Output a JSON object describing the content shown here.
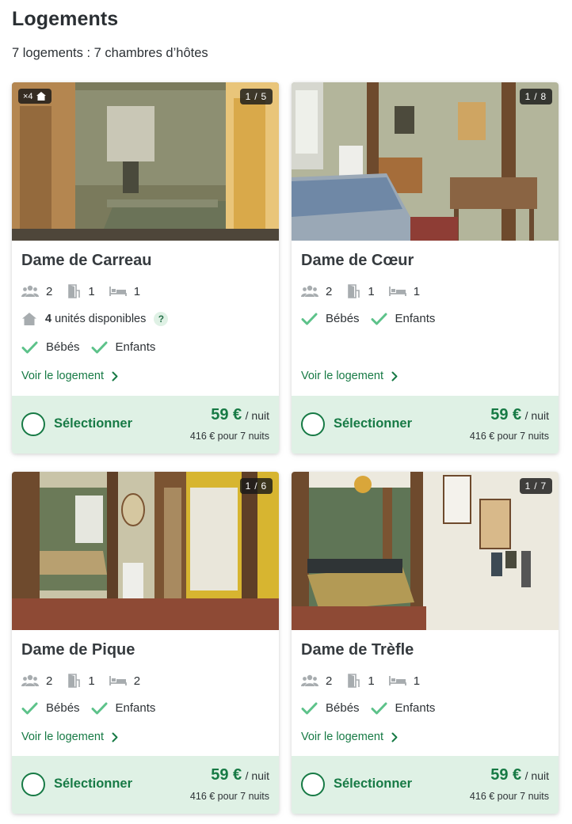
{
  "page": {
    "title": "Logements",
    "subtitle": "7 logements : 7 chambres d’hôtes"
  },
  "listings": [
    {
      "name": "Dame de Carreau",
      "photo_counter": "1 / 5",
      "units_badge": "×4",
      "guests": "2",
      "rooms": "1",
      "beds": "1",
      "availability_count": "4",
      "availability_text": "unités disponibles",
      "availability_help": "?",
      "feature_1": "Bébés",
      "feature_2": "Enfants",
      "link": "Voir le logement",
      "select_label": "Sélectionner",
      "price": "59 €",
      "price_unit": "/ nuit",
      "total": "416 € pour 7 nuits"
    },
    {
      "name": "Dame de Cœur",
      "photo_counter": "1 / 8",
      "guests": "2",
      "rooms": "1",
      "beds": "1",
      "feature_1": "Bébés",
      "feature_2": "Enfants",
      "link": "Voir le logement",
      "select_label": "Sélectionner",
      "price": "59 €",
      "price_unit": "/ nuit",
      "total": "416 € pour 7 nuits"
    },
    {
      "name": "Dame de Pique",
      "photo_counter": "1 / 6",
      "guests": "2",
      "rooms": "1",
      "beds": "2",
      "feature_1": "Bébés",
      "feature_2": "Enfants",
      "link": "Voir le logement",
      "select_label": "Sélectionner",
      "price": "59 €",
      "price_unit": "/ nuit",
      "total": "416 € pour 7 nuits"
    },
    {
      "name": "Dame de Trèfle",
      "photo_counter": "1 / 7",
      "guests": "2",
      "rooms": "1",
      "beds": "1",
      "feature_1": "Bébés",
      "feature_2": "Enfants",
      "link": "Voir le logement",
      "select_label": "Sélectionner",
      "price": "59 €",
      "price_unit": "/ nuit",
      "total": "416 € pour 7 nuits"
    }
  ],
  "icons": {
    "guests": "guests-icon",
    "rooms": "door-icon",
    "beds": "bed-icon",
    "check": "check-icon",
    "availability": "home-icon",
    "link_arrow": "chevron-right-icon"
  },
  "colors": {
    "accent": "#177a45",
    "check": "#5dc28a",
    "footer_bg": "#dff1e5",
    "icon_grey": "#a7acaf"
  }
}
